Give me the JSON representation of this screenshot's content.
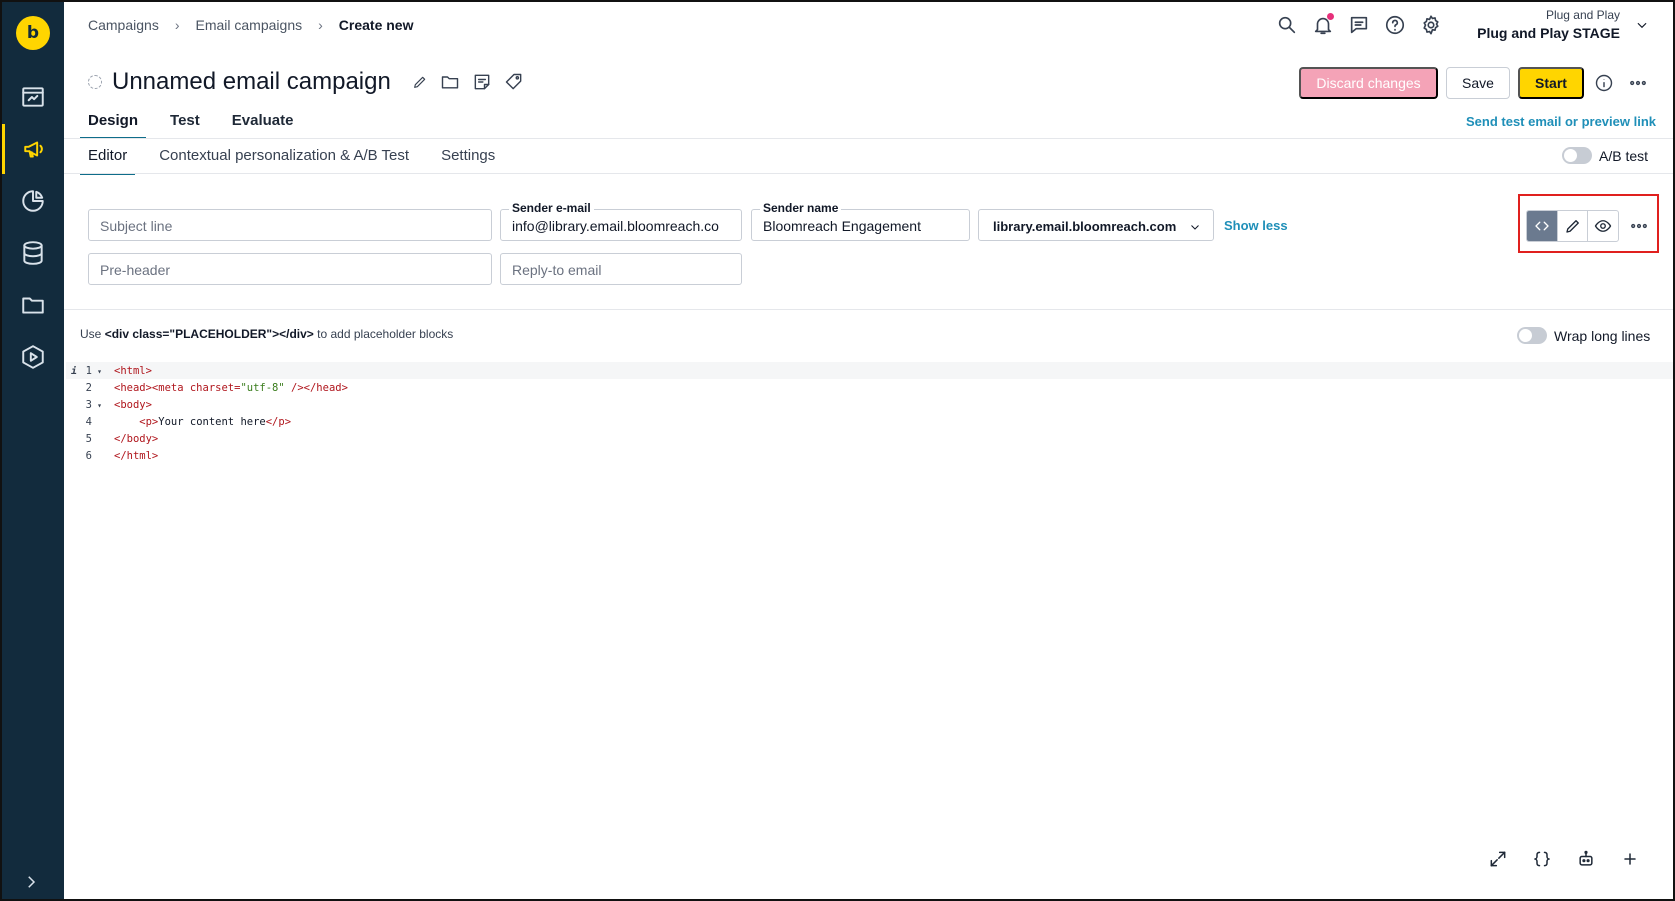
{
  "breadcrumb": [
    "Campaigns",
    "Email campaigns",
    "Create new"
  ],
  "project": {
    "workspace": "Plug and Play",
    "name": "Plug and Play STAGE"
  },
  "campaign": {
    "title": "Unnamed email campaign"
  },
  "actions": {
    "discard": "Discard changes",
    "save": "Save",
    "start": "Start"
  },
  "tabs": [
    "Design",
    "Test",
    "Evaluate"
  ],
  "send_test_link": "Send test email or preview link",
  "subtabs": [
    "Editor",
    "Contextual personalization & A/B Test",
    "Settings"
  ],
  "ab_test_label": "A/B test",
  "fields": {
    "subject_placeholder": "Subject line",
    "sender_email_label": "Sender e-mail",
    "sender_email_value": "info@library.email.bloomreach.co",
    "sender_name_label": "Sender name",
    "sender_name_value": "Bloomreach Engagement",
    "domain_value": "library.email.bloomreach.com",
    "show_less": "Show less",
    "preheader_placeholder": "Pre-header",
    "reply_to_placeholder": "Reply-to email"
  },
  "editor": {
    "hint_prefix": "Use ",
    "hint_code": "<div class=\"PLACEHOLDER\"></div>",
    "hint_suffix": " to add placeholder blocks",
    "wrap_label": "Wrap long lines",
    "line_numbers": [
      "1",
      "2",
      "3",
      "4",
      "5",
      "6"
    ],
    "lines": {
      "l1": "<html>",
      "l2a": "<head><meta charset=",
      "l2b": "\"utf-8\"",
      "l2c": " /></head>",
      "l3": "<body>",
      "l4a": "    <p>",
      "l4b": "Your content here",
      "l4c": "</p>",
      "l5": "</body>",
      "l6": "</html>"
    }
  },
  "logo_glyph": "b",
  "colors": {
    "sidebar": "#122b3d",
    "accent": "#ffd500",
    "link": "#1f8fb8",
    "discard": "#f4a3b7",
    "highlight": "#e0201e"
  }
}
